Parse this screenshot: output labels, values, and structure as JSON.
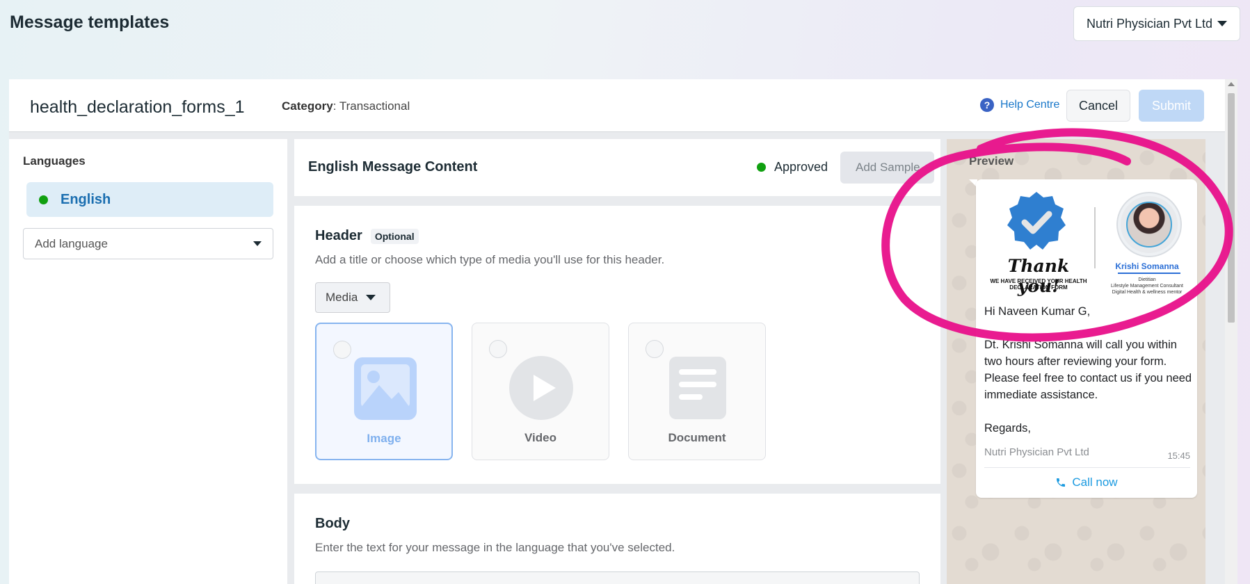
{
  "page": {
    "title": "Message templates"
  },
  "account": {
    "name": "Nutri Physician Pvt Ltd"
  },
  "template": {
    "name": "health_declaration_forms_1",
    "category_label": "Category",
    "category_value": ": Transactional"
  },
  "toolbar": {
    "help_label": "Help Centre",
    "help_glyph": "?",
    "cancel_label": "Cancel",
    "submit_label": "Submit"
  },
  "languages": {
    "title": "Languages",
    "items": [
      {
        "label": "English"
      }
    ],
    "add_placeholder": "Add language"
  },
  "content": {
    "title": "English Message Content",
    "status": "Approved",
    "add_sample_label": "Add Sample"
  },
  "header_section": {
    "title": "Header",
    "badge": "Optional",
    "description": "Add a title or choose which type of media you'll use for this header.",
    "media_select": "Media",
    "options": [
      {
        "label": "Image",
        "selected": true
      },
      {
        "label": "Video",
        "selected": false
      },
      {
        "label": "Document",
        "selected": false
      }
    ]
  },
  "body_section": {
    "title": "Body",
    "description": "Enter the text for your message in the language that you've selected."
  },
  "preview": {
    "title": "Preview",
    "image": {
      "thank_you": "Thank you!",
      "thank_sub": "WE HAVE RECEIVED YOUR HEALTH DECLARATION FORM",
      "person_name": "Krishi Somanna",
      "person_desc": "Dietitian\nLifestyle Management Consultant\nDigital Health & wellness mentor"
    },
    "greeting": "Hi Naveen Kumar G,",
    "body": "Dt. Krishi Somanna will call you within two hours after reviewing your form. Please feel free to contact us if you need immediate assistance.",
    "regards": "Regards,",
    "footer": "Nutri Physician Pvt Ltd",
    "time": "15:45",
    "button_label": "Call now"
  },
  "colors": {
    "accent_blue": "#1877c9",
    "approved_green": "#10a010",
    "annotation_pink": "#e8108a"
  },
  "icons": {
    "account_caret": "chevron-down-icon",
    "help": "question-circle-icon",
    "image": "image-icon",
    "video": "play-icon",
    "document": "document-icon",
    "call": "phone-icon",
    "verified": "verified-badge-icon"
  }
}
